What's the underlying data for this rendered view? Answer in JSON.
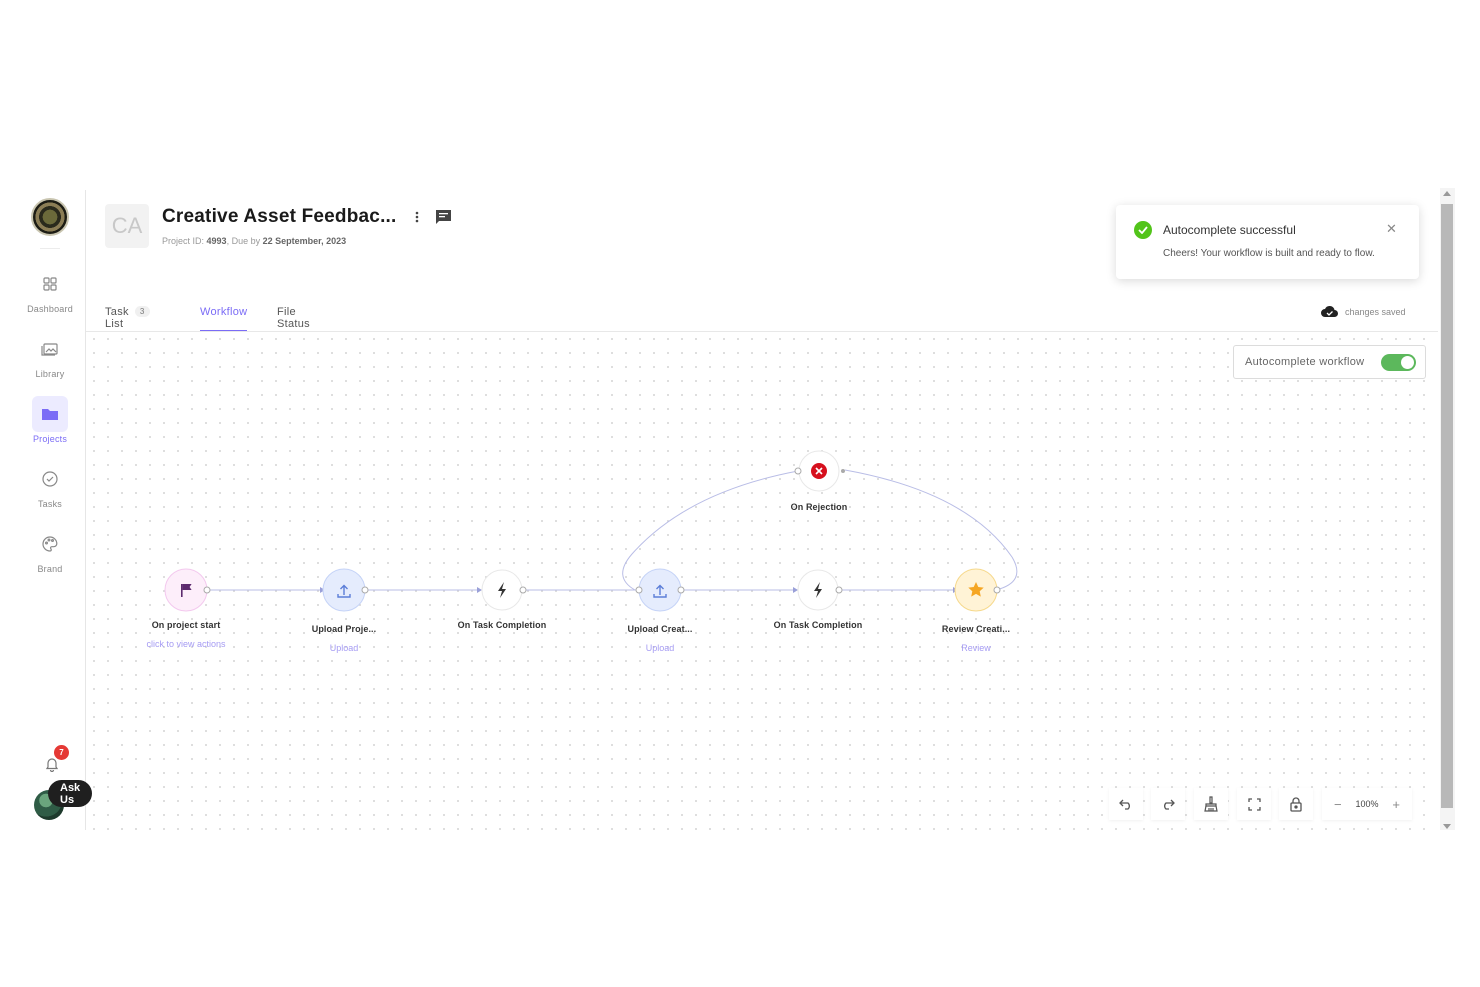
{
  "sidebar": {
    "items": [
      {
        "label": "Dashboard",
        "icon": "dashboard-icon"
      },
      {
        "label": "Library",
        "icon": "library-icon"
      },
      {
        "label": "Projects",
        "icon": "folder-icon",
        "active": true
      },
      {
        "label": "Tasks",
        "icon": "check-circle-icon"
      },
      {
        "label": "Brand",
        "icon": "palette-icon"
      }
    ],
    "notification_count": "7",
    "ask_us": "Ask Us"
  },
  "project": {
    "initials": "CA",
    "title": "Creative Asset Feedbac...",
    "meta_prefix": "Project ID:",
    "id": "4993",
    "due_prefix": ", Due by",
    "due_date": "22 September, 2023"
  },
  "tabs": [
    {
      "label": "Task List",
      "count": "3"
    },
    {
      "label": "Workflow",
      "active": true
    },
    {
      "label": "File Status"
    }
  ],
  "status": {
    "saved": "changes saved"
  },
  "toast": {
    "title": "Autocomplete successful",
    "message": "Cheers! Your workflow is built and ready to flow."
  },
  "autocomplete": {
    "label": "Autocomplete workflow",
    "enabled": true
  },
  "workflow": {
    "nodes": [
      {
        "label": "On project start",
        "sub": "click to view actions",
        "icon": "flag-icon"
      },
      {
        "label": "Upload Proje...",
        "sub": "Upload",
        "icon": "upload-icon"
      },
      {
        "label": "On Task Completion",
        "sub": "",
        "icon": "bolt-icon"
      },
      {
        "label": "Upload Creat...",
        "sub": "Upload",
        "icon": "upload-icon"
      },
      {
        "label": "On Task Completion",
        "sub": "",
        "icon": "bolt-icon"
      },
      {
        "label": "Review Creati...",
        "sub": "Review",
        "icon": "star-icon"
      },
      {
        "label": "On Rejection",
        "sub": "",
        "icon": "x-circle-icon"
      }
    ]
  },
  "zoom": {
    "level": "100%"
  },
  "colors": {
    "accent": "#7b6cf6",
    "success": "#52c41a",
    "toggle": "#5cb85c",
    "danger": "#e02424"
  }
}
